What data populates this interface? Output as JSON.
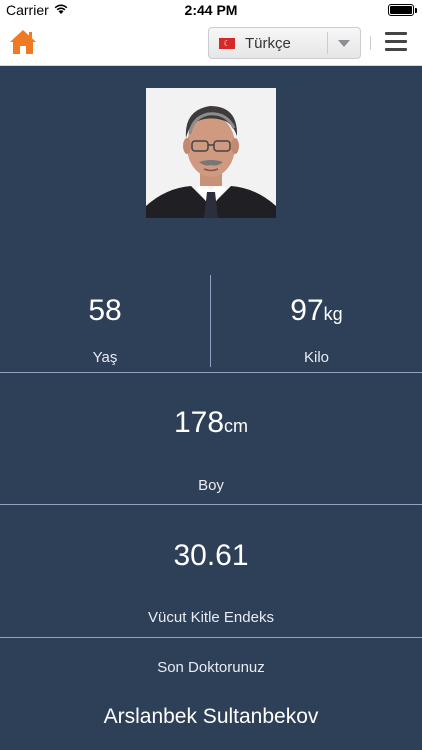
{
  "status_bar": {
    "carrier": "Carrier",
    "time": "2:44 PM"
  },
  "nav": {
    "language": "Türkçe",
    "home_icon": "home-icon",
    "menu_icon": "hamburger-menu-icon",
    "accent": "#f07a24"
  },
  "profile": {
    "age_value": "58",
    "age_label": "Yaş",
    "weight_value": "97",
    "weight_unit": "kg",
    "weight_label": "Kilo",
    "height_value": "178",
    "height_unit": "cm",
    "height_label": "Boy",
    "bmi_value": "30.61",
    "bmi_label": "Vücut Kitle Endeks",
    "doctor_label": "Son Doktorunuz",
    "doctor_name": "Arslanbek Sultanbekov"
  },
  "colors": {
    "background": "#2e3f58",
    "divider": "#8fa3c2"
  }
}
